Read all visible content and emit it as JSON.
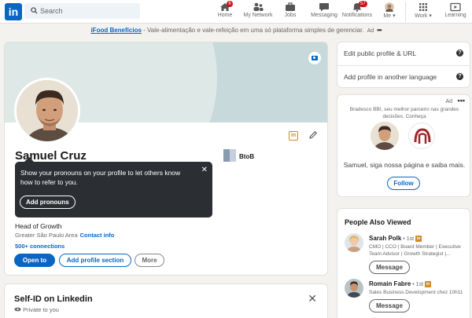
{
  "nav": {
    "logo": "in",
    "search_placeholder": "Search",
    "items": [
      {
        "label": "Home",
        "badge": "6"
      },
      {
        "label": "My Network",
        "badge": ""
      },
      {
        "label": "Jobs",
        "badge": ""
      },
      {
        "label": "Messaging",
        "badge": ""
      },
      {
        "label": "Notifications",
        "badge": "57"
      },
      {
        "label": "Me",
        "badge": ""
      },
      {
        "label": "Work",
        "badge": ""
      },
      {
        "label": "Learning",
        "badge": ""
      }
    ]
  },
  "ad_strip": {
    "link": "iFood Benefícios",
    "text": " - Vale-alimentação e vale-refeição em uma só plataforma simples de gerenciar.",
    "ad_label": "Ad"
  },
  "profile": {
    "name": "Samuel Cruz",
    "company": "BtoB",
    "headline": "Head of Growth",
    "location": "Greater São Paulo Area",
    "contact_info": "Contact info",
    "connections": "500+ connections",
    "open_to": "Open to",
    "add_section": "Add profile section",
    "more": "More",
    "li_badge": "in"
  },
  "tooltip": {
    "message": "Show your pronouns on your profile to let others know how to refer to you.",
    "button": "Add pronouns",
    "close": "✕"
  },
  "selfid": {
    "title": "Self-ID on Linkedin",
    "subtitle": "Private to you",
    "close": "✕"
  },
  "right": {
    "edit_profile": "Edit public profile & URL",
    "add_language": "Add profile in another language",
    "help": "?",
    "ad": {
      "label": "Ad",
      "text": "Bradesco BBI, seu melhor parceiro nas grandes decisões. Conheça",
      "cta": "Samuel, siga nossa página e saiba mais.",
      "follow": "Follow"
    },
    "pav": {
      "heading": "People Also Viewed",
      "people": [
        {
          "name": "Sarah Polk",
          "degree": " • 1st",
          "title": "CMO | CCO | Board Member | Executive Team Advisor | Growth Strategist |...",
          "button": "Message"
        },
        {
          "name": "Romain Fabre",
          "degree": " • 1st",
          "title": "Sales Business Development chez 10h11",
          "button": "Message"
        }
      ]
    }
  },
  "colors": {
    "accent": "#0a66c2",
    "badge": "#cc1016",
    "linkedin_premium": "#d08a2a"
  }
}
